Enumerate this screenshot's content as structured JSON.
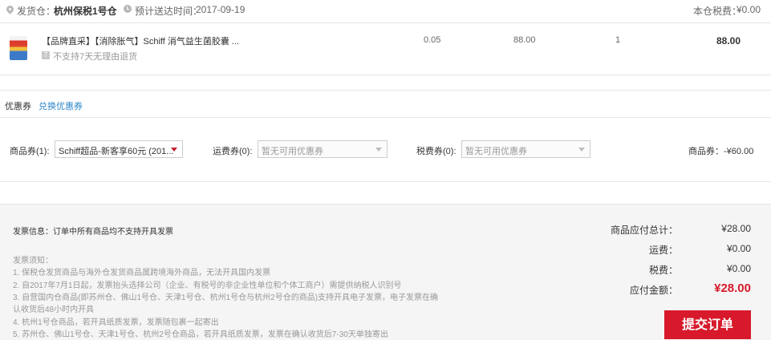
{
  "shipping": {
    "warehouse_label": "发货仓：",
    "warehouse_name": "杭州保税1号仓",
    "delivery_label": "预计送达时间：",
    "delivery_date": "2017-09-19",
    "tax_label": "本仓税费：",
    "tax_value": "¥0.00"
  },
  "product": {
    "title": "【品牌直采】【消除胀气】Schiff 消气益生菌胶囊 ...",
    "return_policy": "不支持7天无理由退货",
    "tax_rate": "0.05",
    "unit_price": "88.00",
    "quantity": "1",
    "subtotal": "88.00"
  },
  "coupons": {
    "section_title": "优惠券",
    "redeem_link": "兑换优惠券",
    "goods_label": "商品券(1):",
    "goods_selected": "Schiff超品-新客享60元 (201...",
    "shipping_label": "运费券(0):",
    "shipping_placeholder": "暂无可用优惠券",
    "tax_label": "税费券(0):",
    "tax_placeholder": "暂无可用优惠券",
    "goods_discount": "商品券：-¥60.00"
  },
  "invoice": {
    "info": "发票信息：订单中所有商品均不支持开具发票",
    "notes_title": "发票须知：",
    "notes": [
      "1. 保税仓发货商品与海外仓发货商品属跨境海外商品，无法开具国内发票",
      "2. 自2017年7月1日起，发票抬头选择公司（企业、有税号的非企业性单位和个体工商户）需提供纳税人识别号",
      "3. 自营国内仓商品(即苏州仓、佛山1号仓、天津1号仓、杭州1号仓与杭州2号仓的商品)支持开具电子发票，电子发票在确",
      "认收货后48小时内开具",
      "4. 杭州1号仓商品，若开具纸质发票，发票随包裹一起寄出",
      "5. 苏州仓、佛山1号仓、天津1号仓、杭州2号仓商品，若开具纸质发票，发票在确认收货后7-30天单独寄出"
    ]
  },
  "summary": {
    "goods_total_label": "商品应付总计：",
    "goods_total": "¥28.00",
    "shipping_label": "运费：",
    "shipping": "¥0.00",
    "tax_label": "税费：",
    "tax": "¥0.00",
    "payable_label": "应付金额：",
    "payable": "¥28.00"
  },
  "submit_label": "提交订单",
  "colors": {
    "accent_red": "#d7192b",
    "link_blue": "#2e87c8"
  }
}
